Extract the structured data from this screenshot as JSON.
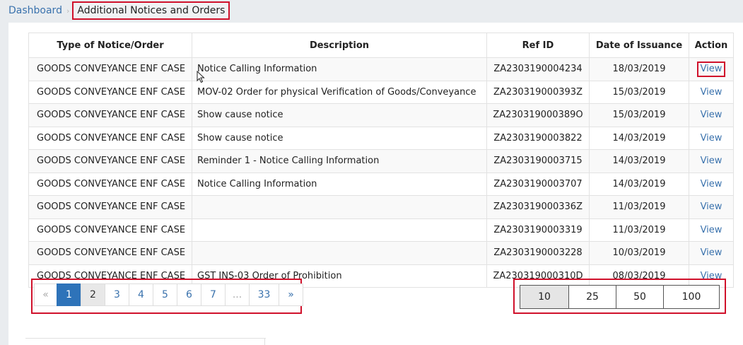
{
  "breadcrumb": {
    "home": "Dashboard",
    "separator": "›",
    "current": "Additional Notices and Orders"
  },
  "table": {
    "headers": [
      "Type of Notice/Order",
      "Description",
      "Ref ID",
      "Date of Issuance",
      "Action"
    ],
    "rows": [
      {
        "type": "GOODS CONVEYANCE ENF CASE",
        "description": "Notice Calling Information",
        "ref_id": "ZA2303190004234",
        "date": "18/03/2019",
        "action": "View"
      },
      {
        "type": "GOODS CONVEYANCE ENF CASE",
        "description": "MOV-02 Order for physical Verification of Goods/Conveyance",
        "ref_id": "ZA230319000393Z",
        "date": "15/03/2019",
        "action": "View"
      },
      {
        "type": "GOODS CONVEYANCE ENF CASE",
        "description": "Show cause notice",
        "ref_id": "ZA230319000389O",
        "date": "15/03/2019",
        "action": "View"
      },
      {
        "type": "GOODS CONVEYANCE ENF CASE",
        "description": "Show cause notice",
        "ref_id": "ZA2303190003822",
        "date": "14/03/2019",
        "action": "View"
      },
      {
        "type": "GOODS CONVEYANCE ENF CASE",
        "description": "Reminder 1 - Notice Calling Information",
        "ref_id": "ZA2303190003715",
        "date": "14/03/2019",
        "action": "View"
      },
      {
        "type": "GOODS CONVEYANCE ENF CASE",
        "description": "Notice Calling Information",
        "ref_id": "ZA2303190003707",
        "date": "14/03/2019",
        "action": "View"
      },
      {
        "type": "GOODS CONVEYANCE ENF CASE",
        "description": "",
        "ref_id": "ZA230319000336Z",
        "date": "11/03/2019",
        "action": "View"
      },
      {
        "type": "GOODS CONVEYANCE ENF CASE",
        "description": "",
        "ref_id": "ZA2303190003319",
        "date": "11/03/2019",
        "action": "View"
      },
      {
        "type": "GOODS CONVEYANCE ENF CASE",
        "description": "",
        "ref_id": "ZA2303190003228",
        "date": "10/03/2019",
        "action": "View"
      },
      {
        "type": "GOODS CONVEYANCE ENF CASE",
        "description": "GST INS-03 Order of Prohibition",
        "ref_id": "ZA230319000310D",
        "date": "08/03/2019",
        "action": "View"
      }
    ]
  },
  "pagination": {
    "prev": "«",
    "pages": [
      "1",
      "2",
      "3",
      "4",
      "5",
      "6",
      "7",
      "...",
      "33"
    ],
    "next": "»",
    "current": "1"
  },
  "page_sizes": {
    "options": [
      "10",
      "25",
      "50",
      "100"
    ],
    "selected": "10"
  },
  "colors": {
    "link": "#3a72ad",
    "active_page": "#2e73b9",
    "highlight_box": "#d0112b"
  },
  "icons": {
    "cursor": "mouse-pointer-icon"
  }
}
